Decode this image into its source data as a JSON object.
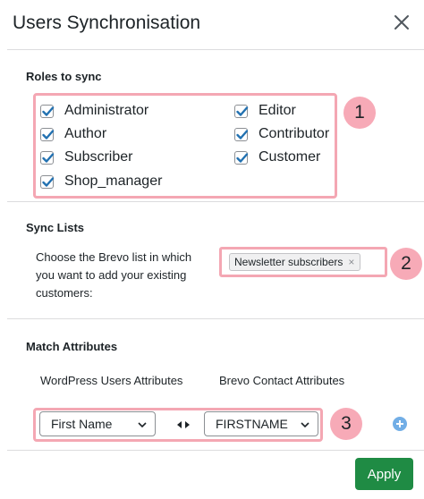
{
  "modal": {
    "title": "Users Synchronisation"
  },
  "roles_section": {
    "title": "Roles to sync",
    "badge": "1",
    "roles": [
      {
        "label": "Administrator",
        "checked": true
      },
      {
        "label": "Editor",
        "checked": true
      },
      {
        "label": "Author",
        "checked": true
      },
      {
        "label": "Contributor",
        "checked": true
      },
      {
        "label": "Subscriber",
        "checked": true
      },
      {
        "label": "Customer",
        "checked": true
      },
      {
        "label": "Shop_manager",
        "checked": true
      }
    ]
  },
  "sync_lists": {
    "title": "Sync Lists",
    "description": "Choose the Brevo list in which you want to add your existing customers:",
    "selected_list": "Newsletter subscribers",
    "remove_glyph": "×",
    "badge": "2"
  },
  "match_attributes": {
    "title": "Match Attributes",
    "wp_column": "WordPress Users Attributes",
    "brevo_column": "Brevo Contact Attributes",
    "wp_value": "First Name",
    "brevo_value": "FIRSTNAME",
    "badge": "3"
  },
  "footer": {
    "apply_label": "Apply"
  },
  "icons": {
    "close": "close-icon",
    "check": "checkmark-icon",
    "chevron": "chevron-down-icon",
    "swap": "swap-arrows-icon",
    "add": "plus-circle-icon"
  },
  "colors": {
    "checkbox_check": "#2271b1",
    "highlight_border": "#f4a7b3",
    "badge_fill": "#f7aab7",
    "apply_button": "#1f8b44",
    "add_icon": "#72aee6"
  }
}
